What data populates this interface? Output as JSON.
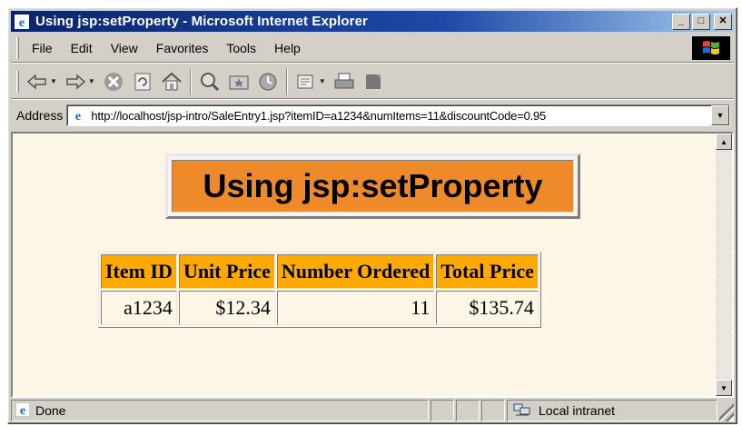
{
  "window": {
    "title": "Using jsp:setProperty - Microsoft Internet Explorer",
    "buttons": {
      "minimize": "_",
      "maximize": "□",
      "close": "✕"
    }
  },
  "menu": {
    "items": [
      {
        "label": "File"
      },
      {
        "label": "Edit"
      },
      {
        "label": "View"
      },
      {
        "label": "Favorites"
      },
      {
        "label": "Tools"
      },
      {
        "label": "Help"
      }
    ]
  },
  "toolbar": {
    "icons": [
      "back-icon",
      "forward-icon",
      "stop-icon",
      "refresh-icon",
      "home-icon",
      "search-icon",
      "favorites-icon",
      "history-icon",
      "mail-icon",
      "print-icon",
      "edit-icon"
    ]
  },
  "address": {
    "label": "Address",
    "url": "http://localhost/jsp-intro/SaleEntry1.jsp?itemID=a1234&numItems=11&discountCode=0.95"
  },
  "page": {
    "heading": "Using jsp:setProperty",
    "table": {
      "headers": [
        "Item ID",
        "Unit Price",
        "Number Ordered",
        "Total Price"
      ],
      "rows": [
        [
          "a1234",
          "$12.34",
          "11",
          "$135.74"
        ]
      ]
    }
  },
  "status": {
    "text": "Done",
    "zone": "Local intranet"
  },
  "colors": {
    "titlebar": "#0a246a",
    "heading_bg": "#ee8a2a",
    "table_header_bg": "#ffaa00",
    "page_bg": "#fdf5e6"
  }
}
